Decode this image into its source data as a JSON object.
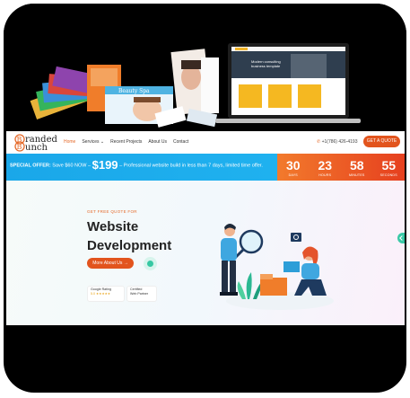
{
  "brand": {
    "part1": "randed",
    "part2": "unch",
    "initial1": "B",
    "initial2": "B"
  },
  "nav": {
    "items": [
      {
        "label": "Home",
        "active": true
      },
      {
        "label": "Services ⌄",
        "active": false
      },
      {
        "label": "Recent Projects",
        "active": false
      },
      {
        "label": "About Us",
        "active": false
      },
      {
        "label": "Contact",
        "active": false
      }
    ],
    "phone": "+1(786) 426-4193",
    "cta": "GET A QUOTE"
  },
  "promo": {
    "prefix": "SPECIAL OFFER:",
    "save": "Save $60 NOW –",
    "price": "$199",
    "suffix": "– Professional website build in less than 7 days, limited time offer."
  },
  "countdown": [
    {
      "value": "30",
      "label": "DAYS"
    },
    {
      "value": "23",
      "label": "HOURS"
    },
    {
      "value": "58",
      "label": "MINUTES"
    },
    {
      "value": "55",
      "label": "SECONDS"
    }
  ],
  "hero": {
    "eyebrow": "GET FREE QUOTE FOR",
    "title_line1": "Website",
    "title_line2": "Development",
    "about_button": "More About Us →",
    "badges": [
      {
        "title": "Google Rating",
        "sub": "5.0 ★★★★★"
      },
      {
        "title": "Certified",
        "sub": "Web Partner"
      }
    ]
  },
  "colors": {
    "accent": "#e2541d",
    "promo_blue": "#1aa7e9",
    "teal": "#39c9a6"
  }
}
